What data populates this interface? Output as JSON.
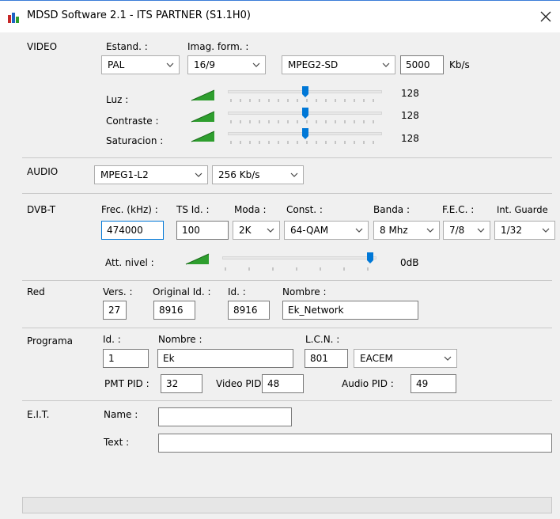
{
  "window": {
    "title": "MDSD Software 2.1 - ITS PARTNER (S1.1H0)"
  },
  "video": {
    "section_label": "VIDEO",
    "estand_label": "Estand. :",
    "estand_value": "PAL",
    "imag_label": "Imag. form. :",
    "imag_value": "16/9",
    "codec_value": "MPEG2-SD",
    "bitrate_value": "5000",
    "bitrate_unit": "Kb/s",
    "luz_label": "Luz :",
    "luz_value": "128",
    "contraste_label": "Contraste :",
    "contraste_value": "128",
    "saturacion_label": "Saturacion :",
    "saturacion_value": "128"
  },
  "audio": {
    "section_label": "AUDIO",
    "codec_value": "MPEG1-L2",
    "bitrate_value": "256 Kb/s"
  },
  "dvbt": {
    "section_label": "DVB-T",
    "frec_label": "Frec. (kHz) :",
    "frec_value": "474000",
    "tsid_label": "TS Id. :",
    "tsid_value": "100",
    "moda_label": "Moda :",
    "moda_value": "2K",
    "const_label": "Const. :",
    "const_value": "64-QAM",
    "banda_label": "Banda :",
    "banda_value": "8 Mhz",
    "fec_label": "F.E.C. :",
    "fec_value": "7/8",
    "guard_label": "Int. Guarde",
    "guard_value": "1/32",
    "att_label": "Att. nivel :",
    "att_value": "0dB"
  },
  "red": {
    "section_label": "Red",
    "vers_label": "Vers. :",
    "vers_value": "27",
    "origid_label": "Original Id. :",
    "origid_value": "8916",
    "id_label": "Id. :",
    "id_value": "8916",
    "nombre_label": "Nombre :",
    "nombre_value": "Ek_Network"
  },
  "programa": {
    "section_label": "Programa",
    "id_label": "Id. :",
    "id_value": "1",
    "nombre_label": "Nombre :",
    "nombre_value": "Ek",
    "lcn_label": "L.C.N. :",
    "lcn_value": "801",
    "lcn_mode_value": "EACEM",
    "pmt_label": "PMT PID :",
    "pmt_value": "32",
    "video_pid_label": "Video PID:",
    "video_pid_value": "48",
    "audio_pid_label": "Audio PID :",
    "audio_pid_value": "49"
  },
  "eit": {
    "section_label": "E.I.T.",
    "name_label": "Name :",
    "name_value": "",
    "text_label": "Text :",
    "text_value": ""
  },
  "icons": {
    "app": "app-bars-icon",
    "close": "close-icon",
    "chevron": "chevron-down-icon",
    "level": "level-ramp-icon"
  },
  "colors": {
    "accent": "#0078d7",
    "ramp": "#2e9e2e"
  },
  "sliders": {
    "luz_level": 0.5,
    "contraste_level": 0.5,
    "saturacion_level": 0.5,
    "att_level": 1.0
  }
}
